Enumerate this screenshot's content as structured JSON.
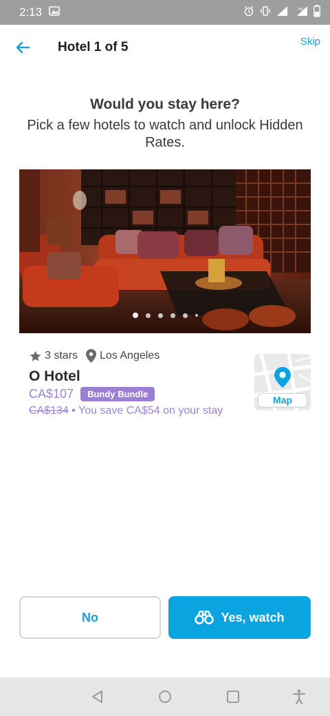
{
  "status_bar": {
    "time": "2:13",
    "icons": [
      "image-icon",
      "alarm-icon",
      "vibrate-icon",
      "signal-icon",
      "lte-signal-icon",
      "battery-icon"
    ]
  },
  "header": {
    "title": "Hotel 1 of 5",
    "skip_label": "Skip",
    "back_icon": "arrow-left-icon"
  },
  "prompt": {
    "title": "Would you stay here?",
    "subtitle": "Pick a few hotels to watch and unlock Hidden Rates."
  },
  "photo": {
    "carousel_dots": 6,
    "active_index": 0
  },
  "hotel": {
    "stars_label": "3 stars",
    "city": "Los Angeles",
    "name": "O Hotel",
    "price": "CA$107",
    "badge": "Bundy Bundle",
    "old_price": "CA$134",
    "savings_text": " • You save CA$54 on your stay"
  },
  "map": {
    "label": "Map"
  },
  "actions": {
    "no_label": "No",
    "yes_label": "Yes, watch"
  },
  "colors": {
    "accent": "#0aa5e0",
    "link": "#1a9fd6",
    "purple": "#9b84d4",
    "badge": "#9b7fd6"
  }
}
